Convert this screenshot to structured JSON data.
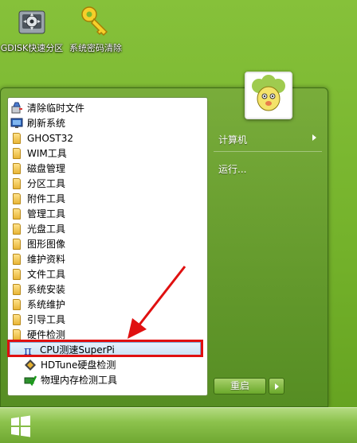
{
  "desktop": {
    "icons": [
      {
        "label": "GDISK快速分区",
        "icon": "gdisk-icon"
      },
      {
        "label": "系统密码清除",
        "icon": "key-icon"
      }
    ]
  },
  "start_menu": {
    "programs": [
      {
        "label": "清除临时文件",
        "icon": "cleaner-icon"
      },
      {
        "label": "刷新系统",
        "icon": "monitor-icon"
      },
      {
        "label": "GHOST32",
        "icon": "folder-icon"
      },
      {
        "label": "WIM工具",
        "icon": "folder-icon"
      },
      {
        "label": "磁盘管理",
        "icon": "folder-icon"
      },
      {
        "label": "分区工具",
        "icon": "folder-icon"
      },
      {
        "label": "附件工具",
        "icon": "folder-icon"
      },
      {
        "label": "管理工具",
        "icon": "folder-icon"
      },
      {
        "label": "光盘工具",
        "icon": "folder-icon"
      },
      {
        "label": "图形图像",
        "icon": "folder-icon"
      },
      {
        "label": "维护资料",
        "icon": "folder-icon"
      },
      {
        "label": "文件工具",
        "icon": "folder-icon"
      },
      {
        "label": "系统安装",
        "icon": "folder-icon"
      },
      {
        "label": "系统维护",
        "icon": "folder-icon"
      },
      {
        "label": "引导工具",
        "icon": "folder-icon"
      },
      {
        "label": "硬件检测",
        "icon": "folder-icon"
      },
      {
        "label": "CPU测速SuperPi",
        "icon": "pi-icon"
      },
      {
        "label": "HDTune硬盘检测",
        "icon": "hdtune-icon"
      },
      {
        "label": "物理内存检测工具",
        "icon": "memory-check-icon"
      }
    ],
    "right": {
      "computer": "计算机",
      "run": "运行..."
    },
    "restart_label": "重启"
  },
  "colors": {
    "highlight": "#e01010",
    "desktop": "#7ab52f"
  }
}
